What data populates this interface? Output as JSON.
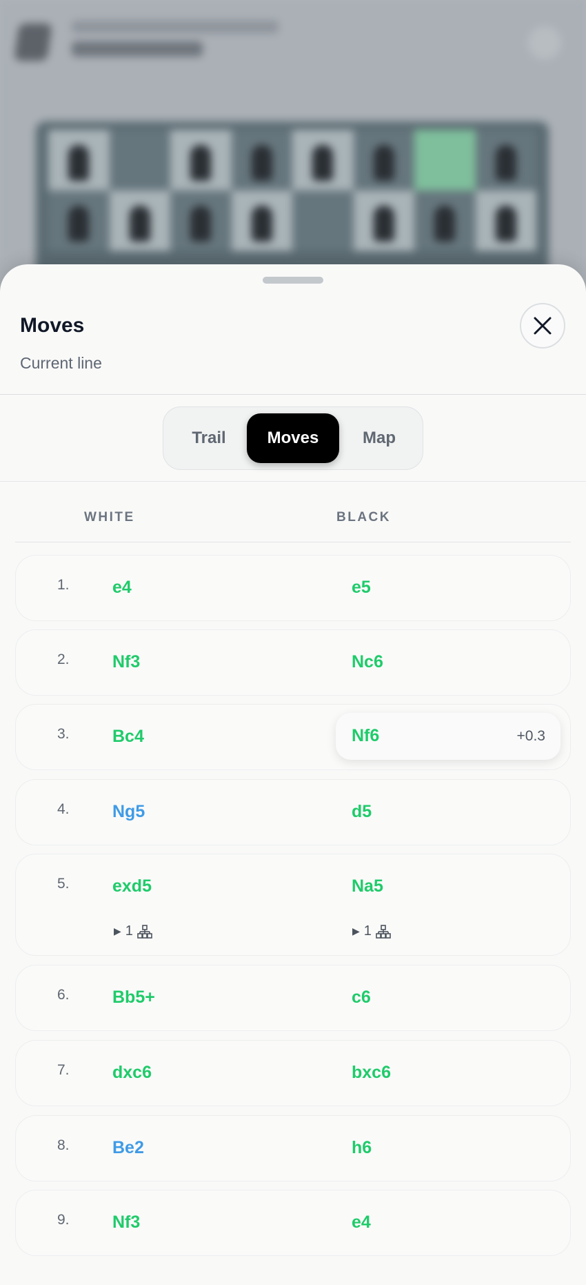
{
  "sheet": {
    "title": "Moves",
    "subtitle": "Current line"
  },
  "tabs": [
    {
      "label": "Trail",
      "active": false
    },
    {
      "label": "Moves",
      "active": true
    },
    {
      "label": "Map",
      "active": false
    }
  ],
  "columns": {
    "white": "WHITE",
    "black": "BLACK"
  },
  "moves": [
    {
      "number": "1.",
      "white": "e4",
      "black": "e5"
    },
    {
      "number": "2.",
      "white": "Nf3",
      "black": "Nc6"
    },
    {
      "number": "3.",
      "white": "Bc4",
      "black": "Nf6",
      "black_eval": "+0.3"
    },
    {
      "number": "4.",
      "white": "Ng5",
      "black": "d5"
    },
    {
      "number": "5.",
      "white": "exd5",
      "black": "Na5",
      "white_variations": "1",
      "black_variations": "1"
    },
    {
      "number": "6.",
      "white": "Bb5+",
      "black": "c6"
    },
    {
      "number": "7.",
      "white": "dxc6",
      "black": "bxc6"
    },
    {
      "number": "8.",
      "white": "Be2",
      "black": "h6"
    },
    {
      "number": "9.",
      "white": "Nf3",
      "black": "e4"
    }
  ],
  "colors": {
    "move_green": "#1fcb6a",
    "move_blue": "#3f9be6",
    "active_tab": "#000000"
  },
  "icons": {
    "close": "close-icon",
    "variation": "branch-icon",
    "expand": "play-arrow-icon"
  }
}
